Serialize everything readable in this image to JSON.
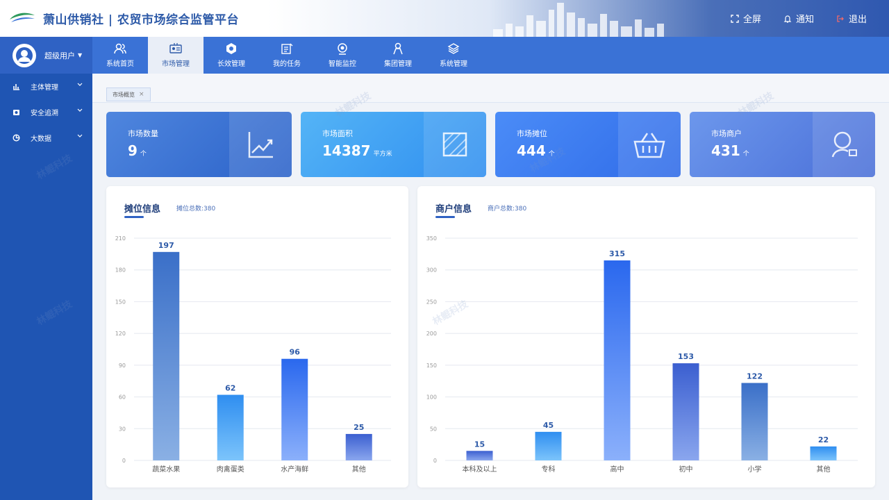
{
  "header": {
    "title": "萧山供销社 | 农贸市场综合监管平台",
    "actions": [
      {
        "label": "全屏",
        "icon": "fullscreen-icon"
      },
      {
        "label": "通知",
        "icon": "bell-icon"
      },
      {
        "label": "退出",
        "icon": "logout-icon"
      }
    ]
  },
  "user": {
    "name": "超级用户"
  },
  "nav": {
    "items": [
      {
        "label": "系统首页",
        "icon": "users-icon"
      },
      {
        "label": "市场管理",
        "icon": "id-card-icon",
        "active": true
      },
      {
        "label": "长效管理",
        "icon": "shield-settings-icon"
      },
      {
        "label": "我的任务",
        "icon": "task-icon"
      },
      {
        "label": "智能监控",
        "icon": "camera-icon"
      },
      {
        "label": "集团管理",
        "icon": "person-icon"
      },
      {
        "label": "系统管理",
        "icon": "layers-icon"
      }
    ]
  },
  "sidebar": {
    "items": [
      {
        "label": "主体管理",
        "icon": "bar-chart-icon"
      },
      {
        "label": "安全追溯",
        "icon": "camera-icon"
      },
      {
        "label": "大数据",
        "icon": "pie-chart-icon"
      }
    ]
  },
  "tabs": [
    {
      "label": "市场概览"
    }
  ],
  "stats": [
    {
      "label": "市场数量",
      "value": "9",
      "unit": "个",
      "color_from": "#4f86de",
      "color_to": "#2b62c9",
      "icon": "growth-chart-icon"
    },
    {
      "label": "市场面积",
      "value": "14387",
      "unit": "平方米",
      "color_from": "#54b4f6",
      "color_to": "#2f8ef0",
      "icon": "area-icon"
    },
    {
      "label": "市场摊位",
      "value": "444",
      "unit": "个",
      "color_from": "#4b8cf7",
      "color_to": "#2f6be8",
      "icon": "basket-icon"
    },
    {
      "label": "市场商户",
      "value": "431",
      "unit": "个",
      "color_from": "#6c97ec",
      "color_to": "#4a6fd8",
      "icon": "person-search-icon"
    }
  ],
  "stall_panel": {
    "title": "摊位信息",
    "subtitle": "摊位总数:380"
  },
  "merchant_panel": {
    "title": "商户信息",
    "subtitle": "商户总数:380"
  },
  "watermark": {
    "text": "林鲲科技"
  },
  "chart_data": [
    {
      "type": "bar",
      "categories": [
        "蔬菜水果",
        "肉禽蛋类",
        "水产海鲜",
        "其他"
      ],
      "values": [
        197,
        62,
        96,
        25
      ],
      "ylim": [
        0,
        210
      ],
      "yticks": [
        0,
        30,
        60,
        90,
        120,
        150,
        180,
        210
      ],
      "grid": true,
      "colors": [
        [
          "#3a6fc8",
          "#8ab0e4"
        ],
        [
          "#2f8ef0",
          "#7cc4fb"
        ],
        [
          "#2a68ee",
          "#8bb0fb"
        ],
        [
          "#3b5fd0",
          "#8aa6ee"
        ]
      ]
    },
    {
      "type": "bar",
      "categories": [
        "本科及以上",
        "专科",
        "高中",
        "初中",
        "小学",
        "其他"
      ],
      "values": [
        15,
        45,
        315,
        153,
        122,
        22
      ],
      "ylim": [
        0,
        350
      ],
      "yticks": [
        0,
        50,
        100,
        150,
        200,
        250,
        300,
        350
      ],
      "grid": true,
      "colors": [
        [
          "#3b5fd0",
          "#8aa6ee"
        ],
        [
          "#2f8ef0",
          "#7cc4fb"
        ],
        [
          "#2a68ee",
          "#8bb0fb"
        ],
        [
          "#3b5fd0",
          "#8aa6ee"
        ],
        [
          "#3a6fc8",
          "#8ab0e4"
        ],
        [
          "#2f8ef0",
          "#7cc4fb"
        ]
      ]
    }
  ]
}
